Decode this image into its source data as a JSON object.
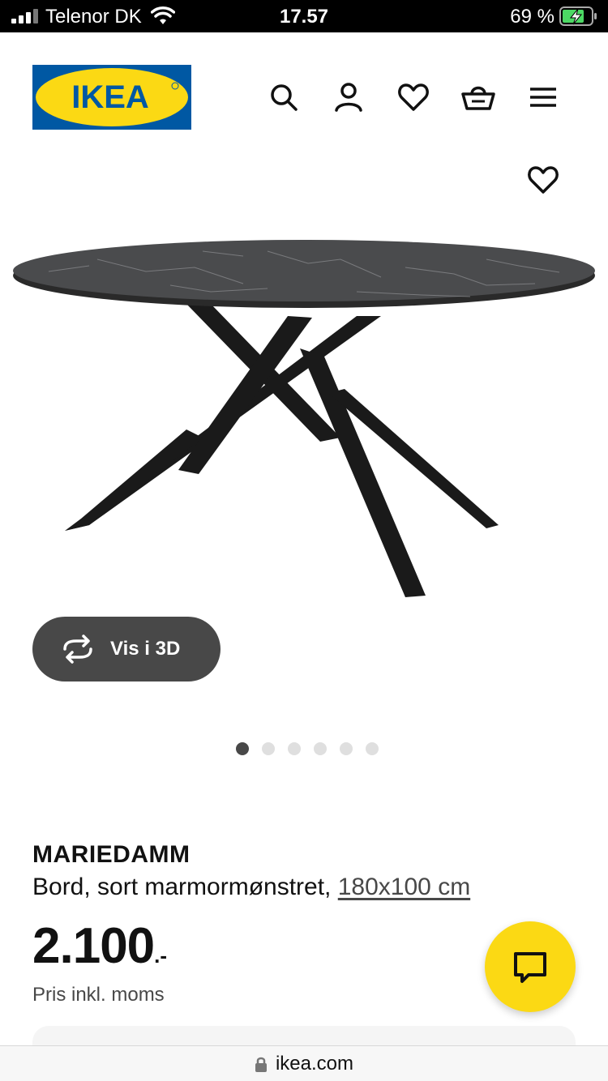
{
  "status_bar": {
    "carrier": "Telenor DK",
    "time": "17.57",
    "battery": "69 %",
    "icons": [
      "signal-icon",
      "wifi-icon",
      "battery-charging-icon"
    ]
  },
  "header": {
    "logo_text": "IKEA",
    "icons": [
      "search-icon",
      "account-icon",
      "favorites-icon",
      "basket-icon",
      "menu-icon"
    ]
  },
  "gallery": {
    "view_3d_label": "Vis i 3D",
    "image_count": 6,
    "active_index": 0
  },
  "product": {
    "name": "MARIEDAMM",
    "description": "Bord, sort marmormønstret,",
    "size": "180x100 cm",
    "price": "2.100",
    "price_suffix": ".-",
    "price_note": "Pris inkl. moms"
  },
  "browser": {
    "url": "ikea.com"
  },
  "colors": {
    "brand_blue": "#0058a3",
    "brand_yellow": "#fbd914",
    "button_dark": "#484848",
    "dot_inactive": "#dfdfdf"
  }
}
